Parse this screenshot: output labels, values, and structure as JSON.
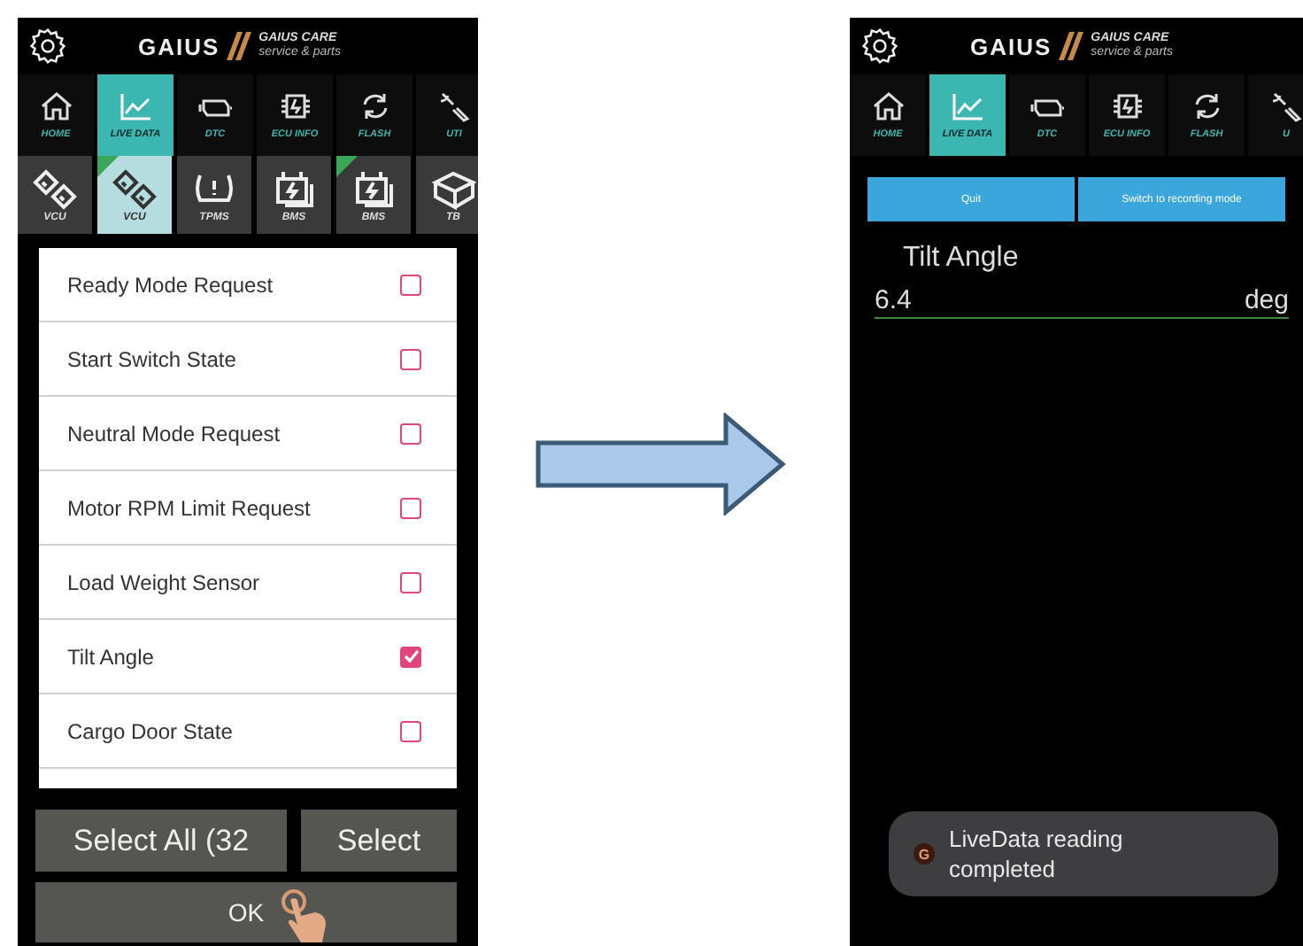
{
  "left_screen": {
    "header": {
      "brand": "GAIUS",
      "sub_brand": "GAIUS CARE",
      "tagline": "service & parts"
    },
    "nav_tabs": [
      {
        "label": "HOME",
        "kind": "home",
        "selected": false
      },
      {
        "label": "LIVE DATA",
        "kind": "chart",
        "selected": true
      },
      {
        "label": "DTC",
        "kind": "engine",
        "selected": false
      },
      {
        "label": "ECU INFO",
        "kind": "chip",
        "selected": false
      },
      {
        "label": "FLASH",
        "kind": "refresh",
        "selected": false
      },
      {
        "label": "UTI",
        "kind": "wrench",
        "selected": false
      }
    ],
    "modules": [
      {
        "label": "VCU",
        "kind": "links",
        "badge": false,
        "selected": false
      },
      {
        "label": "VCU",
        "kind": "links",
        "badge": true,
        "selected": true
      },
      {
        "label": "TPMS",
        "kind": "tire",
        "badge": false,
        "selected": false
      },
      {
        "label": "BMS",
        "kind": "battery",
        "badge": false,
        "selected": false
      },
      {
        "label": "BMS",
        "kind": "battery",
        "badge": true,
        "selected": false
      },
      {
        "label": "TB",
        "kind": "box",
        "badge": false,
        "selected": false
      }
    ],
    "parameters": [
      {
        "name": "Ready Mode Request",
        "checked": false
      },
      {
        "name": "Start Switch State",
        "checked": false
      },
      {
        "name": "Neutral Mode Request",
        "checked": false
      },
      {
        "name": "Motor RPM Limit Request",
        "checked": false
      },
      {
        "name": "Load Weight Sensor",
        "checked": false
      },
      {
        "name": "Tilt Angle",
        "checked": true
      },
      {
        "name": "Cargo Door State",
        "checked": false
      }
    ],
    "buttons": [
      "Select All (32",
      "Select"
    ],
    "ok_button": "OK"
  },
  "right_screen": {
    "header": {
      "brand": "GAIUS",
      "sub_brand": "GAIUS CARE",
      "tagline": "service & parts"
    },
    "nav_tabs": [
      {
        "label": "HOME",
        "kind": "home",
        "selected": false
      },
      {
        "label": "LIVE DATA",
        "kind": "chart",
        "selected": true
      },
      {
        "label": "DTC",
        "kind": "engine",
        "selected": false
      },
      {
        "label": "ECU INFO",
        "kind": "chip",
        "selected": false
      },
      {
        "label": "FLASH",
        "kind": "refresh",
        "selected": false
      },
      {
        "label": "U",
        "kind": "wrench",
        "selected": false
      }
    ],
    "buttons": [
      "Quit",
      "Switch to recording mode"
    ],
    "reading": {
      "name": "Tilt Angle",
      "value": "6.4",
      "unit": "deg"
    },
    "toast": {
      "app_letter": "G",
      "message": "LiveData reading completed"
    }
  }
}
